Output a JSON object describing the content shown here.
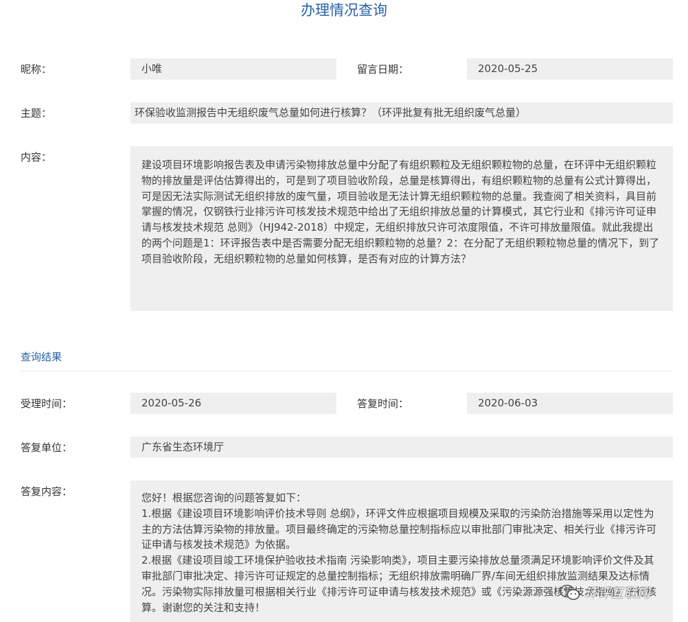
{
  "page": {
    "title": "办理情况查询"
  },
  "inquiry": {
    "nickname_label": "昵称：",
    "nickname": "小唯",
    "date_label": "留言日期：",
    "date": "2020-05-25",
    "subject_label": "主题：",
    "subject": "环保验收监测报告中无组织废气总量如何进行核算？（环评批复有批无组织废气总量）",
    "content_label": "内容：",
    "content": "建设项目环境影响报告表及申请污染物排放总量中分配了有组织颗粒及无组织颗粒物的总量，在环评中无组织颗粒物的排放量是评估估算得出的，可是到了项目验收阶段，总量是核算得出，有组织颗粒物的总量有公式计算得出，可是因无法实际测试无组织排放的废气量，项目验收是无法计算无组织颗粒物的总量。我查阅了相关资料，具目前掌握的情况，仅钢铁行业排污许可核发技术规范中给出了无组织排放总量的计算模式，其它行业和《排污许可证申请与核发技术规范 总则》（HJ942-2018）中规定，无组织排放只许可浓度限值，不许可排放量限值。就此我提出的两个问题是1：环评报告表中是否需要分配无组织颗粒物的总量？2：在分配了无组织颗粒物总量的情况下，到了项目验收阶段，无组织颗粒物的总量如何核算，是否有对应的计算方法？"
  },
  "result": {
    "section_title": "查询结果",
    "accept_time_label": "受理时间：",
    "accept_time": "2020-05-26",
    "reply_time_label": "答复时间：",
    "reply_time": "2020-06-03",
    "reply_unit_label": "答复单位：",
    "reply_unit": "广东省生态环境厅",
    "reply_content_label": "答复内容：",
    "reply_content": "您好！根据您咨询的问题答复如下：\n1.根据《建设项目环境影响评价技术导则 总纲》，环评文件应根据项目规模及采取的污染防治措施等采用以定性为主的方法估算污染物的排放量。项目最终确定的污染物总量控制指标应以审批部门审批决定、相关行业《排污许可证申请与核发技术规范》为依据。\n2.根据《建设项目竣工环境保护验收技术指南 污染影响类》，项目主要污染排放总量须满足环境影响评价文件及其审批部门审批决定、排污许可证规定的总量控制指标；无组织排放需明确厂界/车间无组织排放监测结果及达标情况。污染物实际排放量可根据相关行业《排污许可证申请与核发技术规范》或《污染源源强核算技术指南》进行核算。谢谢您的关注和支持！"
  },
  "watermark": {
    "text": "环评互联网",
    "icon": "wechat-icon"
  }
}
